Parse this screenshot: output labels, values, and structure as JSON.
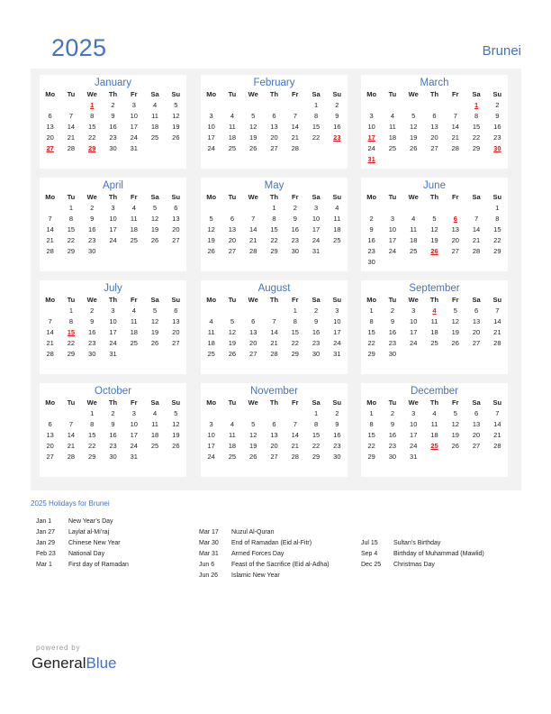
{
  "header": {
    "year": "2025",
    "country": "Brunei"
  },
  "weekday_labels": [
    "Mo",
    "Tu",
    "We",
    "Th",
    "Fr",
    "Sa",
    "Su"
  ],
  "accent_color": "#4472c4",
  "holiday_color": "#e0191b",
  "months": [
    {
      "name": "January",
      "start": 2,
      "days": 31,
      "holidays": [
        1,
        27,
        29
      ]
    },
    {
      "name": "February",
      "start": 5,
      "days": 28,
      "holidays": [
        23
      ]
    },
    {
      "name": "March",
      "start": 5,
      "days": 31,
      "holidays": [
        1,
        17,
        30,
        31
      ]
    },
    {
      "name": "April",
      "start": 1,
      "days": 30,
      "holidays": []
    },
    {
      "name": "May",
      "start": 3,
      "days": 31,
      "holidays": []
    },
    {
      "name": "June",
      "start": 6,
      "days": 30,
      "holidays": [
        6,
        26
      ]
    },
    {
      "name": "July",
      "start": 1,
      "days": 31,
      "holidays": [
        15
      ]
    },
    {
      "name": "August",
      "start": 4,
      "days": 31,
      "holidays": []
    },
    {
      "name": "September",
      "start": 0,
      "days": 30,
      "holidays": [
        4
      ]
    },
    {
      "name": "October",
      "start": 2,
      "days": 31,
      "holidays": []
    },
    {
      "name": "November",
      "start": 5,
      "days": 30,
      "holidays": []
    },
    {
      "name": "December",
      "start": 0,
      "days": 31,
      "holidays": [
        25
      ]
    }
  ],
  "holidays_section": {
    "title": "2025 Holidays for Brunei",
    "columns": [
      [
        {
          "date": "Jan 1",
          "name": "New Year’s Day"
        },
        {
          "date": "Jan 27",
          "name": "Laylat al-Mi’raj"
        },
        {
          "date": "Jan 29",
          "name": "Chinese New Year"
        },
        {
          "date": "Feb 23",
          "name": "National Day"
        },
        {
          "date": "Mar 1",
          "name": "First day of Ramadan"
        }
      ],
      [
        {
          "date": "Mar 17",
          "name": "Nuzul Al-Quran"
        },
        {
          "date": "Mar 30",
          "name": "End of Ramadan (Eid al-Fitr)"
        },
        {
          "date": "Mar 31",
          "name": "Armed Forces Day"
        },
        {
          "date": "Jun 6",
          "name": "Feast of the Sacrifice (Eid al-Adha)"
        },
        {
          "date": "Jun 26",
          "name": "Islamic New Year"
        }
      ],
      [
        {
          "date": "Jul 15",
          "name": "Sultan’s Birthday"
        },
        {
          "date": "Sep 4",
          "name": "Birthday of Muhammad (Mawlid)"
        },
        {
          "date": "Dec 25",
          "name": "Christmas Day"
        }
      ]
    ]
  },
  "footer": {
    "powered_by": "powered by",
    "brand_general": "General",
    "brand_blue": "Blue"
  }
}
